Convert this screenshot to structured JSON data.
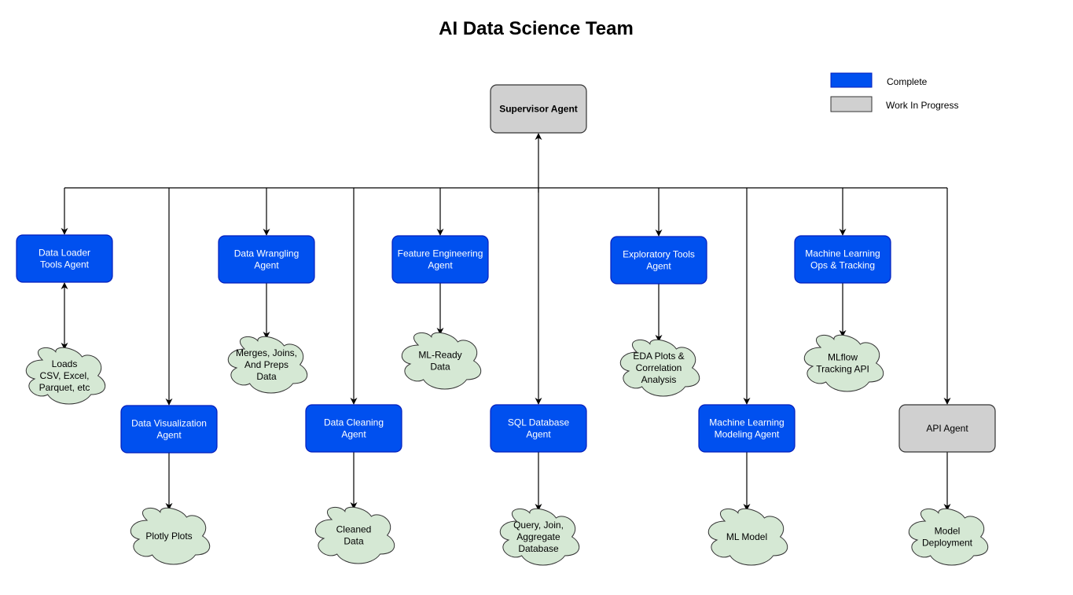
{
  "title": "AI Data Science Team",
  "colors": {
    "complete_fill": "#0050EF",
    "complete_stroke": "#001DBC",
    "wip_fill": "#D0D0D0",
    "wip_stroke": "#333333",
    "cloud_fill": "#D5E8D4",
    "cloud_stroke": "#333333",
    "complete_text": "#FFFFFF",
    "wip_text": "#000000"
  },
  "legend": [
    {
      "label": "Complete",
      "status": "complete"
    },
    {
      "label": "Work In Progress",
      "status": "wip"
    }
  ],
  "supervisor": {
    "lines": [
      "Supervisor Agent"
    ],
    "status": "wip"
  },
  "agents": [
    {
      "id": "data-loader",
      "lines": [
        "Data Loader",
        "Tools Agent"
      ],
      "status": "complete",
      "output": [
        "Loads",
        "CSV, Excel,",
        "Parquet, etc"
      ],
      "bidirectional": true
    },
    {
      "id": "data-visualization",
      "lines": [
        "Data Visualization",
        "Agent"
      ],
      "status": "complete",
      "output": [
        "Plotly Plots"
      ],
      "bidirectional": false
    },
    {
      "id": "data-wrangling",
      "lines": [
        "Data Wrangling",
        "Agent"
      ],
      "status": "complete",
      "output": [
        "Merges, Joins,",
        "And Preps",
        "Data"
      ],
      "bidirectional": false
    },
    {
      "id": "data-cleaning",
      "lines": [
        "Data Cleaning",
        "Agent"
      ],
      "status": "complete",
      "output": [
        "Cleaned",
        "Data"
      ],
      "bidirectional": false
    },
    {
      "id": "feature-engineering",
      "lines": [
        "Feature Engineering",
        "Agent"
      ],
      "status": "complete",
      "output": [
        "ML-Ready",
        "Data"
      ],
      "bidirectional": false
    },
    {
      "id": "sql-database",
      "lines": [
        "SQL Database",
        "Agent"
      ],
      "status": "complete",
      "output": [
        "Query, Join,",
        "Aggregate",
        "Database"
      ],
      "bidirectional": false
    },
    {
      "id": "exploratory-tools",
      "lines": [
        "Exploratory Tools",
        "Agent"
      ],
      "status": "complete",
      "output": [
        "EDA Plots &",
        "Correlation",
        "Analysis"
      ],
      "bidirectional": false
    },
    {
      "id": "ml-modeling",
      "lines": [
        "Machine Learning",
        "Modeling Agent"
      ],
      "status": "complete",
      "output": [
        "ML Model"
      ],
      "bidirectional": false
    },
    {
      "id": "mlops-tracking",
      "lines": [
        "Machine Learning",
        "Ops & Tracking"
      ],
      "status": "complete",
      "output": [
        "MLflow",
        "Tracking API"
      ],
      "bidirectional": false
    },
    {
      "id": "api-agent",
      "lines": [
        "API Agent"
      ],
      "status": "wip",
      "output": [
        "Model",
        "Deployment"
      ],
      "bidirectional": false
    }
  ]
}
